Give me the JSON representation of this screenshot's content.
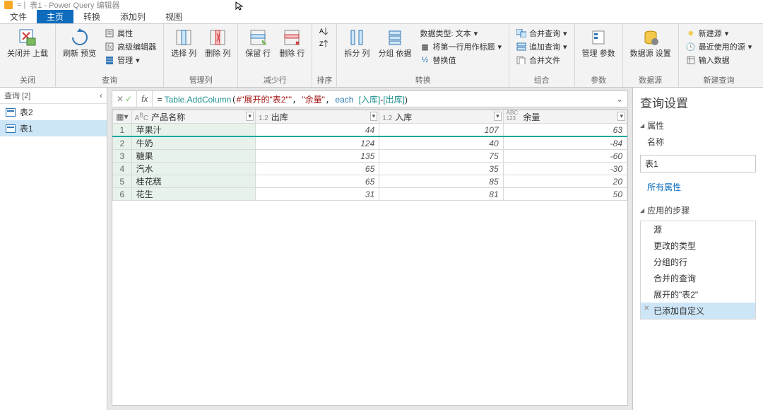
{
  "titlebar": {
    "text": "表1 - Power Query 编辑器"
  },
  "tabs": [
    "文件",
    "主页",
    "转换",
    "添加列",
    "视图"
  ],
  "active_tab": 1,
  "ribbon": {
    "groups": [
      {
        "label": "关闭",
        "big": [
          {
            "label": "关闭并\n上载",
            "icon": "close-load"
          }
        ]
      },
      {
        "label": "查询",
        "big": [
          {
            "label": "刷新\n预览",
            "icon": "refresh"
          }
        ],
        "small": [
          {
            "label": "属性",
            "icon": "props"
          },
          {
            "label": "高级编辑器",
            "icon": "adv"
          },
          {
            "label": "管理",
            "icon": "manage"
          }
        ]
      },
      {
        "label": "管理列",
        "big": [
          {
            "label": "选择\n列",
            "icon": "select-col"
          },
          {
            "label": "删除\n列",
            "icon": "del-col"
          }
        ]
      },
      {
        "label": "减少行",
        "big": [
          {
            "label": "保留\n行",
            "icon": "keep-row"
          },
          {
            "label": "删除\n行",
            "icon": "del-row"
          }
        ]
      },
      {
        "label": "排序",
        "big": [
          {
            "label": "",
            "icon": "sort-asc"
          },
          {
            "label": "",
            "icon": "sort-desc"
          }
        ],
        "stack": true
      },
      {
        "label": "",
        "big": [
          {
            "label": "拆分\n列",
            "icon": "split"
          },
          {
            "label": "分组\n依据",
            "icon": "group"
          }
        ],
        "small": [
          {
            "label": "数据类型: 文本",
            "icon": "dtype"
          },
          {
            "label": "将第一行用作标题",
            "icon": "first-row"
          },
          {
            "label": "替换值",
            "icon": "replace"
          }
        ],
        "glabel": "转换"
      },
      {
        "label": "组合",
        "small": [
          {
            "label": "合并查询",
            "icon": "merge"
          },
          {
            "label": "追加查询",
            "icon": "append"
          },
          {
            "label": "合并文件",
            "icon": "combine-files"
          }
        ]
      },
      {
        "label": "参数",
        "big": [
          {
            "label": "管理\n参数",
            "icon": "params"
          }
        ]
      },
      {
        "label": "数据源",
        "big": [
          {
            "label": "数据源\n设置",
            "icon": "ds"
          }
        ]
      },
      {
        "label": "新建查询",
        "small": [
          {
            "label": "新建源",
            "icon": "new-src"
          },
          {
            "label": "最近使用的源",
            "icon": "recent"
          },
          {
            "label": "输入数据",
            "icon": "enter-data"
          }
        ]
      }
    ]
  },
  "queries_pane": {
    "header": "查询 [2]",
    "items": [
      {
        "name": "表2"
      },
      {
        "name": "表1",
        "selected": true
      }
    ]
  },
  "formula": {
    "prefix": "= ",
    "fn": "Table.AddColumn",
    "arg1": "#\"展开的\"表2\"\"",
    "arg2": "\"余量\"",
    "arg3_kw": "each",
    "arg3a": "[入库]",
    "arg3op": "-",
    "arg3b": "[出库]",
    "close": ")"
  },
  "grid": {
    "columns": [
      {
        "type": "ABC",
        "name": "产品名称"
      },
      {
        "type": "1.2",
        "name": "出库"
      },
      {
        "type": "1.2",
        "name": "入库"
      },
      {
        "type": "ABC\n123",
        "name": "余量"
      }
    ],
    "rows": [
      {
        "n": "苹果汁",
        "a": 44,
        "b": 107,
        "c": 63
      },
      {
        "n": "牛奶",
        "a": 124,
        "b": 40,
        "c": -84
      },
      {
        "n": "糖果",
        "a": 135,
        "b": 75,
        "c": -60
      },
      {
        "n": "汽水",
        "a": 65,
        "b": 35,
        "c": -30
      },
      {
        "n": "桂花糕",
        "a": 65,
        "b": 85,
        "c": 20
      },
      {
        "n": "花生",
        "a": 31,
        "b": 81,
        "c": 50
      }
    ]
  },
  "settings": {
    "title": "查询设置",
    "sect_props": "属性",
    "name_label": "名称",
    "name_value": "表1",
    "all_props": "所有属性",
    "sect_steps": "应用的步骤",
    "steps": [
      {
        "label": "源"
      },
      {
        "label": "更改的类型"
      },
      {
        "label": "分组的行"
      },
      {
        "label": "合并的查询"
      },
      {
        "label": "展开的\"表2\""
      },
      {
        "label": "已添加自定义",
        "selected": true,
        "x": true
      }
    ]
  }
}
